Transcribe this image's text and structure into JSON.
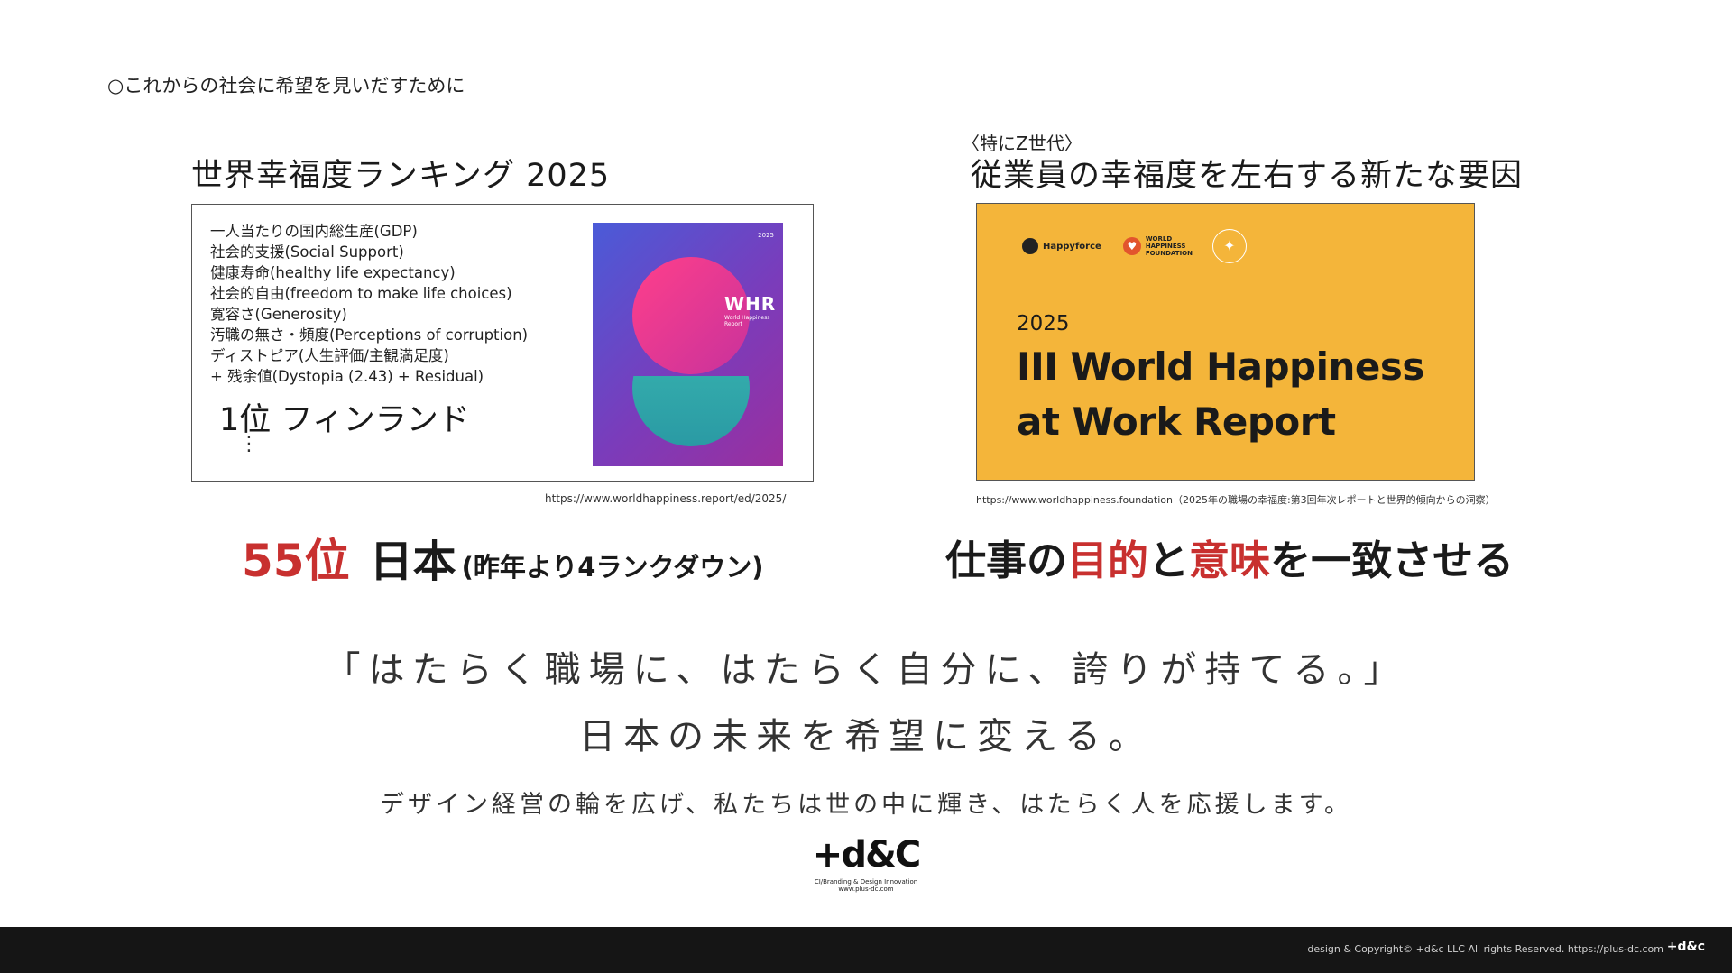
{
  "header": {
    "heading": "○これからの社会に希望を見いだすために"
  },
  "left": {
    "title": "世界幸福度ランキング 2025",
    "factors": [
      "一人当たりの国内総生産(GDP)",
      "社会的支援(Social Support)",
      "健康寿命(healthy life expectancy)",
      "社会的自由(freedom to make life choices)",
      "寛容さ(Generosity)",
      "汚職の無さ・頻度(Perceptions of corruption)",
      "ディストピア(人生評価/主観満足度)",
      "+ 残余値(Dystopia (2.43) + Residual)"
    ],
    "rank1": "1位 フィンランド",
    "dots": "⋮",
    "cover": {
      "year": "2025",
      "logo": "WHR",
      "subtitle": "World Happiness Report"
    },
    "url": "https://www.worldhappiness.report/ed/2025/",
    "japan_rank": "55位",
    "japan_name": "日本",
    "japan_note": "(昨年より4ランクダウン)"
  },
  "right": {
    "sub_label": "〈特にZ世代〉",
    "title": "従業員の幸福度を左右する新たな要因",
    "logos": {
      "happyforce": "Happyforce",
      "whf": "WORLD HAPPINESS FOUNDATION"
    },
    "report_year": "2025",
    "report_title": "III World Happiness at Work Report",
    "url": "https://www.worldhappiness.foundation（2025年の職場の幸福度:第3回年次レポートと世界的傾向からの洞察）",
    "purpose_a": "仕事の",
    "purpose_b": "目的",
    "purpose_c": "と",
    "purpose_d": "意味",
    "purpose_e": "を一致させる"
  },
  "slogan": {
    "line1": "「はたらく職場に、はたらく自分に、誇りが持てる。」",
    "line2": "日本の未来を希望に変える。",
    "line3": "デザイン経営の輪を広げ、私たちは世の中に輝き、はたらく人を応援します。"
  },
  "brand": {
    "mark": "+d&C",
    "tagline": "CI/Branding & Design Innovation",
    "url": "www.plus-dc.com"
  },
  "footer": {
    "copyright": "design & Copyright© +d&c LLC All rights Reserved.    https://plus-dc.com",
    "logo": "+d&c"
  },
  "colors": {
    "accent_red": "#c8302f",
    "report_yellow": "#f4b53a",
    "footer_bg": "#151515"
  }
}
